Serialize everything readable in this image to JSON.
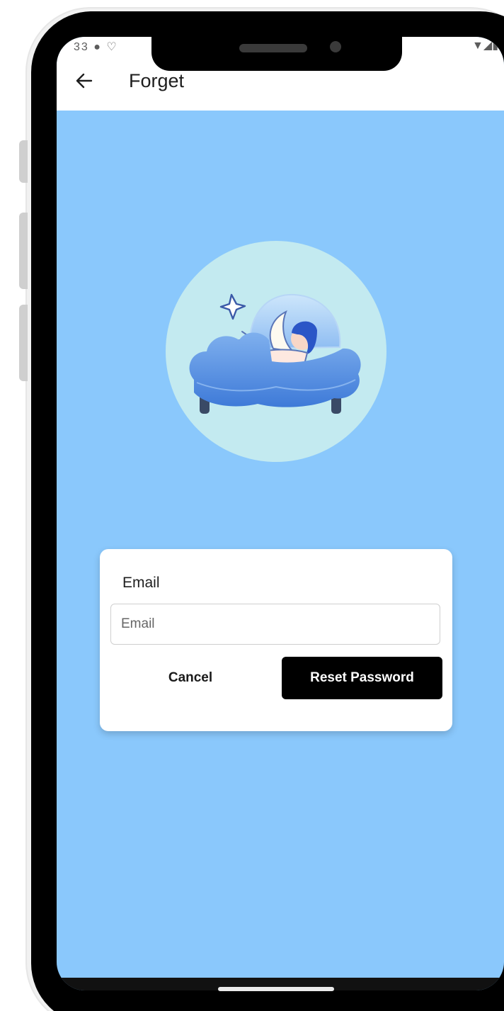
{
  "status_bar": {
    "left_icons": "33 ● ♡",
    "right_icons": "▼◢▮"
  },
  "app_bar": {
    "back_icon": "arrow-left-icon",
    "title": "Forget"
  },
  "hero": {
    "illustration": "sleeping-cloud-bed-illustration"
  },
  "form": {
    "email_label": "Email",
    "email_placeholder": "Email",
    "email_value": "",
    "cancel_label": "Cancel",
    "reset_label": "Reset Password"
  },
  "colors": {
    "background": "#8ac8fc",
    "card": "#ffffff",
    "primary_button": "#000000",
    "hero_circle": "#c3eaf0"
  }
}
